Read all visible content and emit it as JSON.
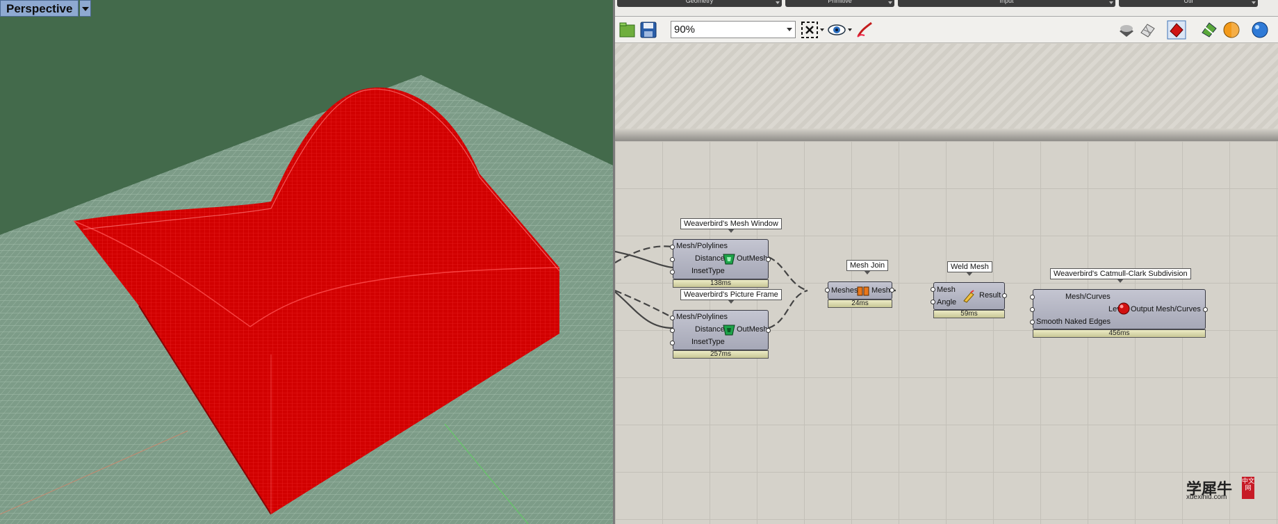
{
  "viewport": {
    "title": "Perspective"
  },
  "tabs": [
    "Geometry",
    "Primitive",
    "Input",
    "Util"
  ],
  "toolbar": {
    "zoom": "90%"
  },
  "components": {
    "mesh_window": {
      "title": "Weaverbird's Mesh Window",
      "inputs": [
        "Mesh/Polylines",
        "Distance",
        "InsetType"
      ],
      "output": "OutMesh",
      "time": "138ms"
    },
    "picture_frame": {
      "title": "Weaverbird's Picture Frame",
      "inputs": [
        "Mesh/Polylines",
        "Distance",
        "InsetType"
      ],
      "output": "OutMesh",
      "time": "257ms"
    },
    "mesh_join": {
      "title": "Mesh Join",
      "input": "Meshes",
      "output": "Mesh",
      "time": "24ms"
    },
    "weld_mesh": {
      "title": "Weld Mesh",
      "inputs": [
        "Mesh",
        "Angle"
      ],
      "output": "Result",
      "time": "59ms"
    },
    "catmull": {
      "title": "Weaverbird's Catmull-Clark Subdivision",
      "inputs": [
        "Mesh/Curves",
        "Level",
        "Smooth Naked Edges"
      ],
      "output": "Output Mesh/Curves",
      "time": "456ms"
    }
  },
  "watermark": {
    "cn": "学犀牛",
    "url": "xuexiniu.com",
    "badge": "中文网"
  },
  "colors": {
    "viewport_bg": "#436a4b",
    "mesh_red": "#d10000",
    "canvas": "#d5d2ca",
    "timer": "#d9d8ad"
  }
}
